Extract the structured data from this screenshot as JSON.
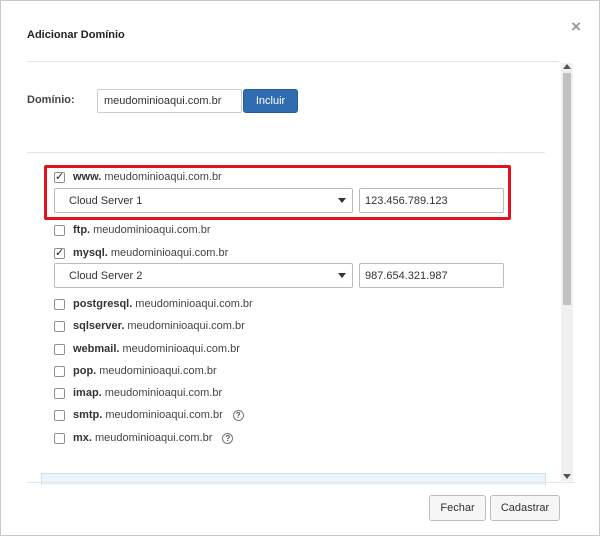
{
  "modal": {
    "title": "Adicionar Domínio",
    "close_label": "×"
  },
  "domain_form": {
    "label": "Domínio:",
    "value": "meudominioaqui.com.br",
    "include_label": "Incluir"
  },
  "base_domain": "meudominioaqui.com.br",
  "subdomains": [
    {
      "prefix": "www.",
      "checked": true,
      "server": "Cloud Server 1",
      "ip": "123.456.789.123"
    },
    {
      "prefix": "ftp.",
      "checked": false
    },
    {
      "prefix": "mysql.",
      "checked": true,
      "server": "Cloud Server 2",
      "ip": "987.654.321.987"
    },
    {
      "prefix": "postgresql.",
      "checked": false
    },
    {
      "prefix": "sqlserver.",
      "checked": false
    },
    {
      "prefix": "webmail.",
      "checked": false
    },
    {
      "prefix": "pop.",
      "checked": false
    },
    {
      "prefix": "imap.",
      "checked": false
    },
    {
      "prefix": "smtp.",
      "checked": false,
      "help": "?"
    },
    {
      "prefix": "mx.",
      "checked": false,
      "help": "?"
    }
  ],
  "footer": {
    "close_label": "Fechar",
    "submit_label": "Cadastrar"
  },
  "colors": {
    "primary_button": "#2f6cb0",
    "highlight": "#e0131b"
  }
}
